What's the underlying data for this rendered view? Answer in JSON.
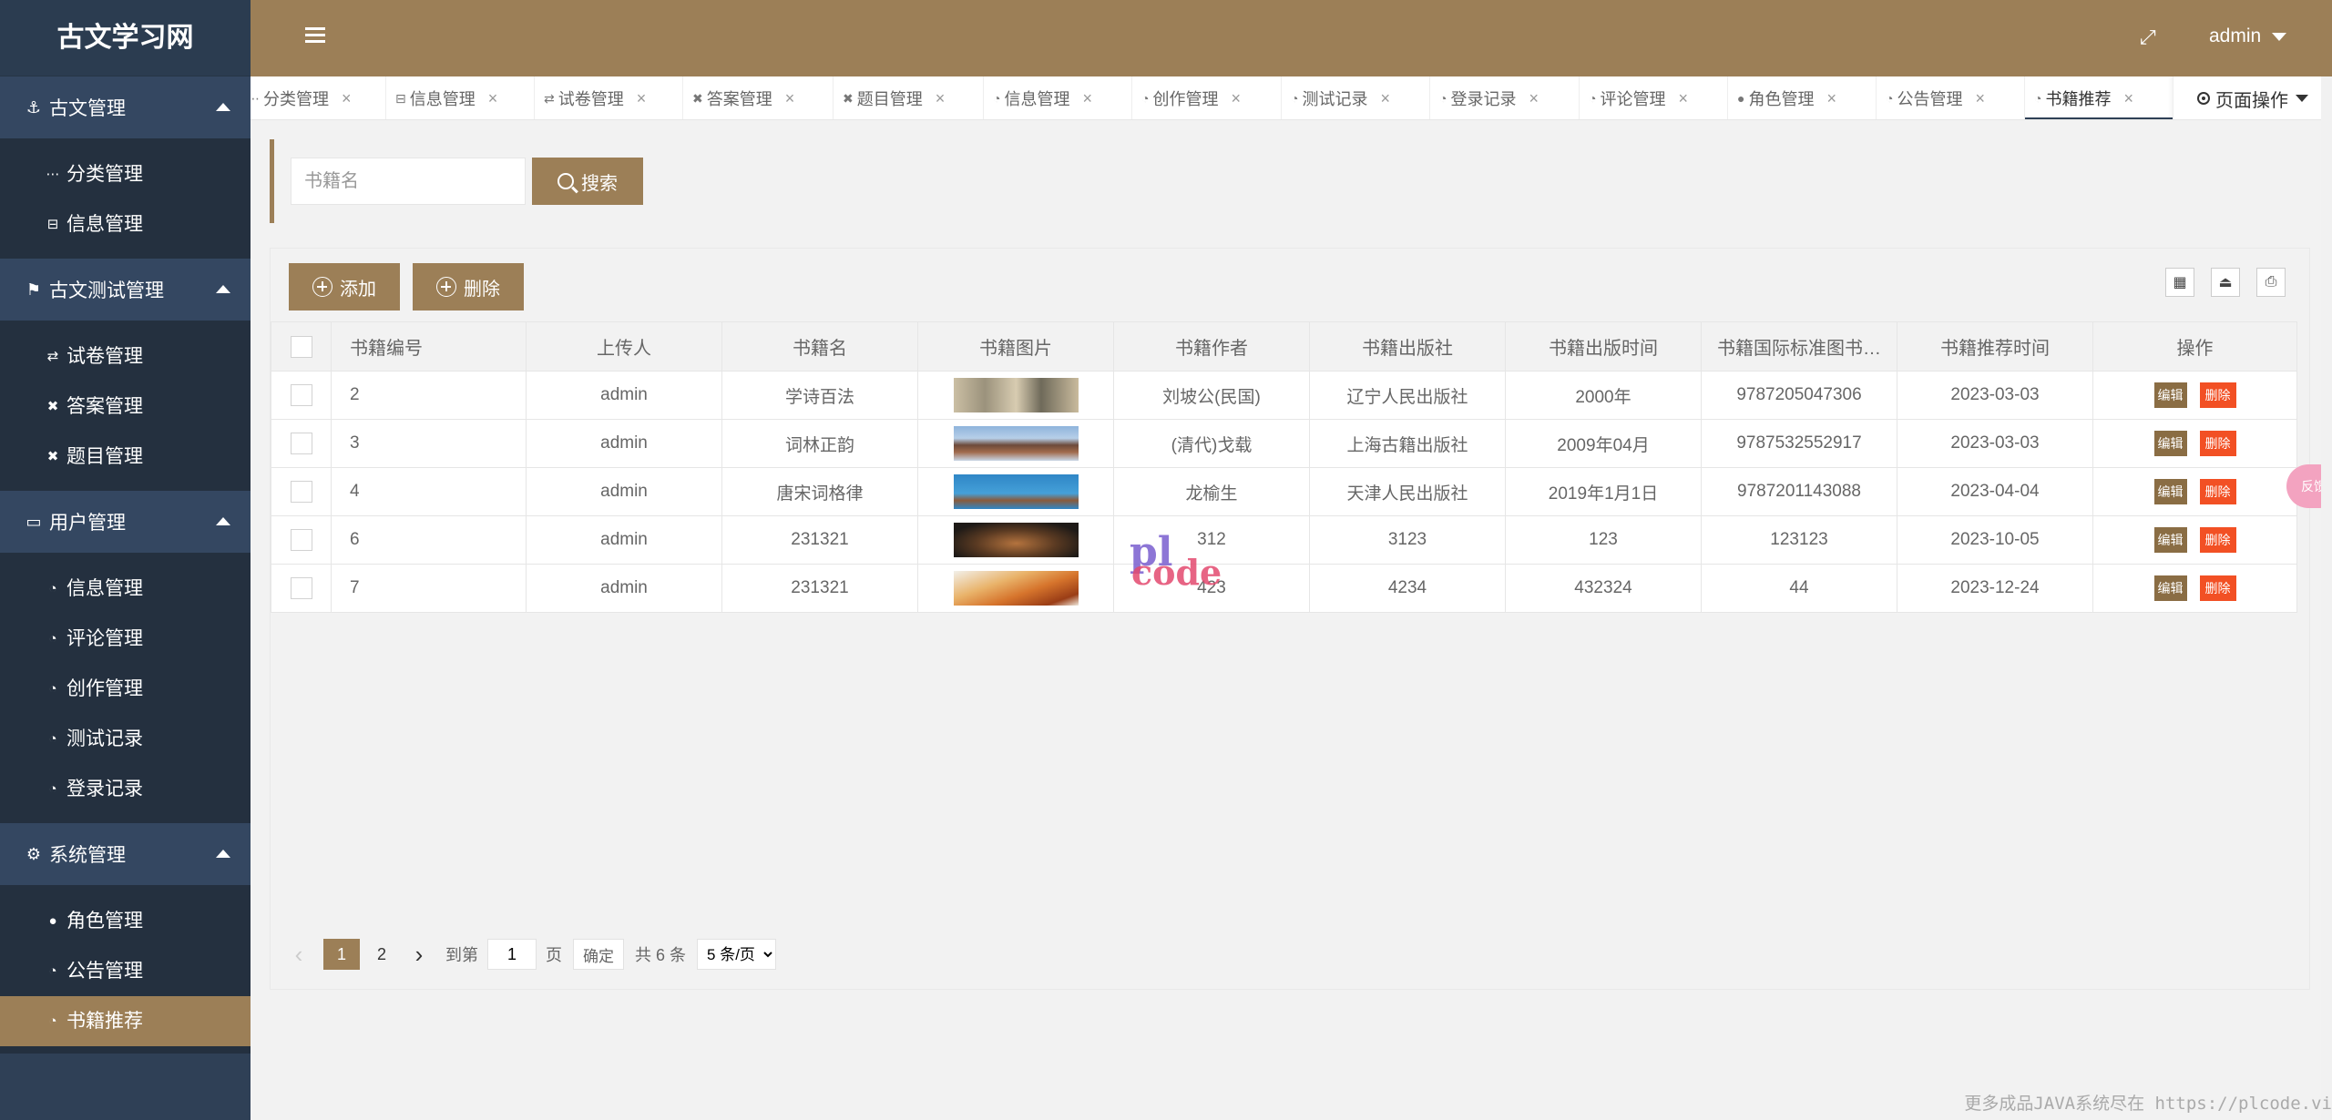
{
  "app": {
    "title": "古文学习网"
  },
  "header": {
    "user_name": "admin"
  },
  "sidebar": {
    "groups": [
      {
        "label": "古文管理",
        "icon": "anchor-icon",
        "items": [
          {
            "label": "分类管理",
            "icon": "dots-icon"
          },
          {
            "label": "信息管理",
            "icon": "hdd-icon"
          }
        ]
      },
      {
        "label": "古文测试管理",
        "icon": "flag-icon",
        "items": [
          {
            "label": "试卷管理",
            "icon": "exchange-icon"
          },
          {
            "label": "答案管理",
            "icon": "user-x-icon"
          },
          {
            "label": "题目管理",
            "icon": "user-x-icon"
          }
        ]
      },
      {
        "label": "用户管理",
        "icon": "desktop-icon",
        "items": [
          {
            "label": "信息管理",
            "icon": "dashboard-icon"
          },
          {
            "label": "评论管理",
            "icon": "dashboard-icon"
          },
          {
            "label": "创作管理",
            "icon": "dashboard-icon"
          },
          {
            "label": "测试记录",
            "icon": "dashboard-icon"
          },
          {
            "label": "登录记录",
            "icon": "dashboard-icon"
          }
        ]
      },
      {
        "label": "系统管理",
        "icon": "cogs-icon",
        "items": [
          {
            "label": "角色管理",
            "icon": "user-icon"
          },
          {
            "label": "公告管理",
            "icon": "dashboard-icon"
          },
          {
            "label": "书籍推荐",
            "icon": "dashboard-icon"
          }
        ]
      }
    ],
    "active_item": "书籍推荐"
  },
  "tabs": [
    {
      "label": "分类管理",
      "icon": "dots-icon"
    },
    {
      "label": "信息管理",
      "icon": "hdd-icon"
    },
    {
      "label": "试卷管理",
      "icon": "exchange-icon"
    },
    {
      "label": "答案管理",
      "icon": "user-x-icon"
    },
    {
      "label": "题目管理",
      "icon": "user-x-icon"
    },
    {
      "label": "信息管理",
      "icon": "dashboard-icon"
    },
    {
      "label": "创作管理",
      "icon": "dashboard-icon"
    },
    {
      "label": "测试记录",
      "icon": "dashboard-icon"
    },
    {
      "label": "登录记录",
      "icon": "dashboard-icon"
    },
    {
      "label": "评论管理",
      "icon": "dashboard-icon"
    },
    {
      "label": "角色管理",
      "icon": "user-icon"
    },
    {
      "label": "公告管理",
      "icon": "dashboard-icon"
    },
    {
      "label": "书籍推荐",
      "icon": "dashboard-icon",
      "active": true
    }
  ],
  "tab_close_glyph": "×",
  "page_ops_label": "页面操作",
  "search": {
    "placeholder": "书籍名",
    "button_label": "搜索"
  },
  "toolbar": {
    "add_label": "添加",
    "delete_label": "删除"
  },
  "table": {
    "columns": [
      "书籍编号",
      "上传人",
      "书籍名",
      "书籍图片",
      "书籍作者",
      "书籍出版社",
      "书籍出版时间",
      "书籍国际标准图书…",
      "书籍推荐时间",
      "操作"
    ],
    "rows": [
      {
        "id": "2",
        "uploader": "admin",
        "name": "学诗百法",
        "image": "landscape-painting",
        "author": "刘坡公(民国)",
        "publisher": "辽宁人民出版社",
        "pub_time": "2000年",
        "isbn": "9787205047306",
        "rec_time": "2023-03-03"
      },
      {
        "id": "3",
        "uploader": "admin",
        "name": "词林正韵",
        "image": "pagoda-photo",
        "author": "(清代)戈载",
        "publisher": "上海古籍出版社",
        "pub_time": "2009年04月",
        "isbn": "9787532552917",
        "rec_time": "2023-03-03"
      },
      {
        "id": "4",
        "uploader": "admin",
        "name": "唐宋词格律",
        "image": "blue-sky-photo",
        "author": "龙榆生",
        "publisher": "天津人民出版社",
        "pub_time": "2019年1月1日",
        "isbn": "9787201143088",
        "rec_time": "2023-04-04"
      },
      {
        "id": "6",
        "uploader": "admin",
        "name": "231321",
        "image": "food-photo-dark",
        "author": "312",
        "publisher": "3123",
        "pub_time": "123",
        "isbn": "123123",
        "rec_time": "2023-10-05"
      },
      {
        "id": "7",
        "uploader": "admin",
        "name": "231321",
        "image": "food-photo-orange",
        "author": "423",
        "publisher": "4234",
        "pub_time": "432324",
        "isbn": "44",
        "rec_time": "2023-12-24"
      }
    ],
    "edit_label": "编辑",
    "delete_label": "删除"
  },
  "pagination": {
    "pages": [
      "1",
      "2"
    ],
    "current": "1",
    "goto_label": "到第",
    "goto_value": "1",
    "page_unit": "页",
    "confirm_label": "确定",
    "total_label": "共 6 条",
    "page_size_label": "5 条/页"
  },
  "watermark": {
    "logo_top": "pl",
    "logo_bottom": "code",
    "footer": "更多成品JAVA系统尽在 https://plcode.vi"
  },
  "side_float_label": "反馈",
  "colors": {
    "sidebar_bg": "#2f4056",
    "header_bg": "#9c7f57",
    "accent": "#9c7f57",
    "danger": "#f25024"
  }
}
